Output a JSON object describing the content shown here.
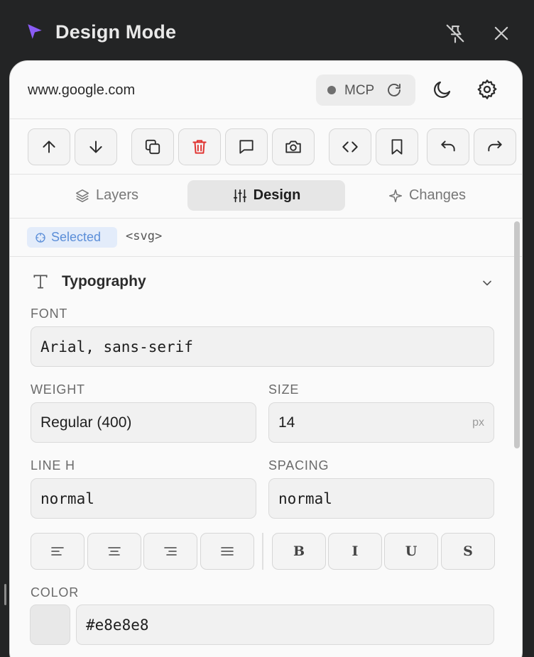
{
  "window": {
    "title": "Design Mode",
    "accent": "#8b5cf6",
    "icons": [
      "cursor-icon",
      "unpin-icon",
      "close-icon"
    ]
  },
  "header": {
    "url": "www.google.com",
    "mcp_label": "MCP",
    "icons": [
      "refresh-icon",
      "moon-icon",
      "gear-icon"
    ]
  },
  "toolbar": {
    "buttons": [
      "arrow-up-icon",
      "arrow-down-icon",
      "duplicate-icon",
      "trash-icon",
      "comment-icon",
      "camera-icon",
      "code-icon",
      "bookmark-icon",
      "undo-icon",
      "redo-icon"
    ],
    "delete_color": "#e0322f"
  },
  "tabs": [
    {
      "label": "Layers",
      "icon": "layers-icon",
      "active": false
    },
    {
      "label": "Design",
      "icon": "sliders-icon",
      "active": true
    },
    {
      "label": "Changes",
      "icon": "sparkle-icon",
      "active": false
    }
  ],
  "selection": {
    "badge": "Selected",
    "element": "<svg>"
  },
  "typography": {
    "title": "Typography",
    "font_label": "FONT",
    "font_value": "Arial, sans-serif",
    "weight_label": "WEIGHT",
    "weight_value": "Regular (400)",
    "size_label": "SIZE",
    "size_value": "14",
    "size_unit": "px",
    "lineh_label": "LINE H",
    "lineh_value": "normal",
    "spacing_label": "SPACING",
    "spacing_value": "normal",
    "align_buttons": [
      "align-left-icon",
      "align-center-icon",
      "align-right-icon",
      "align-justify-icon"
    ],
    "style_buttons": [
      "B",
      "I",
      "U",
      "S"
    ],
    "color_label": "COLOR",
    "color_value": "#e8e8e8"
  }
}
